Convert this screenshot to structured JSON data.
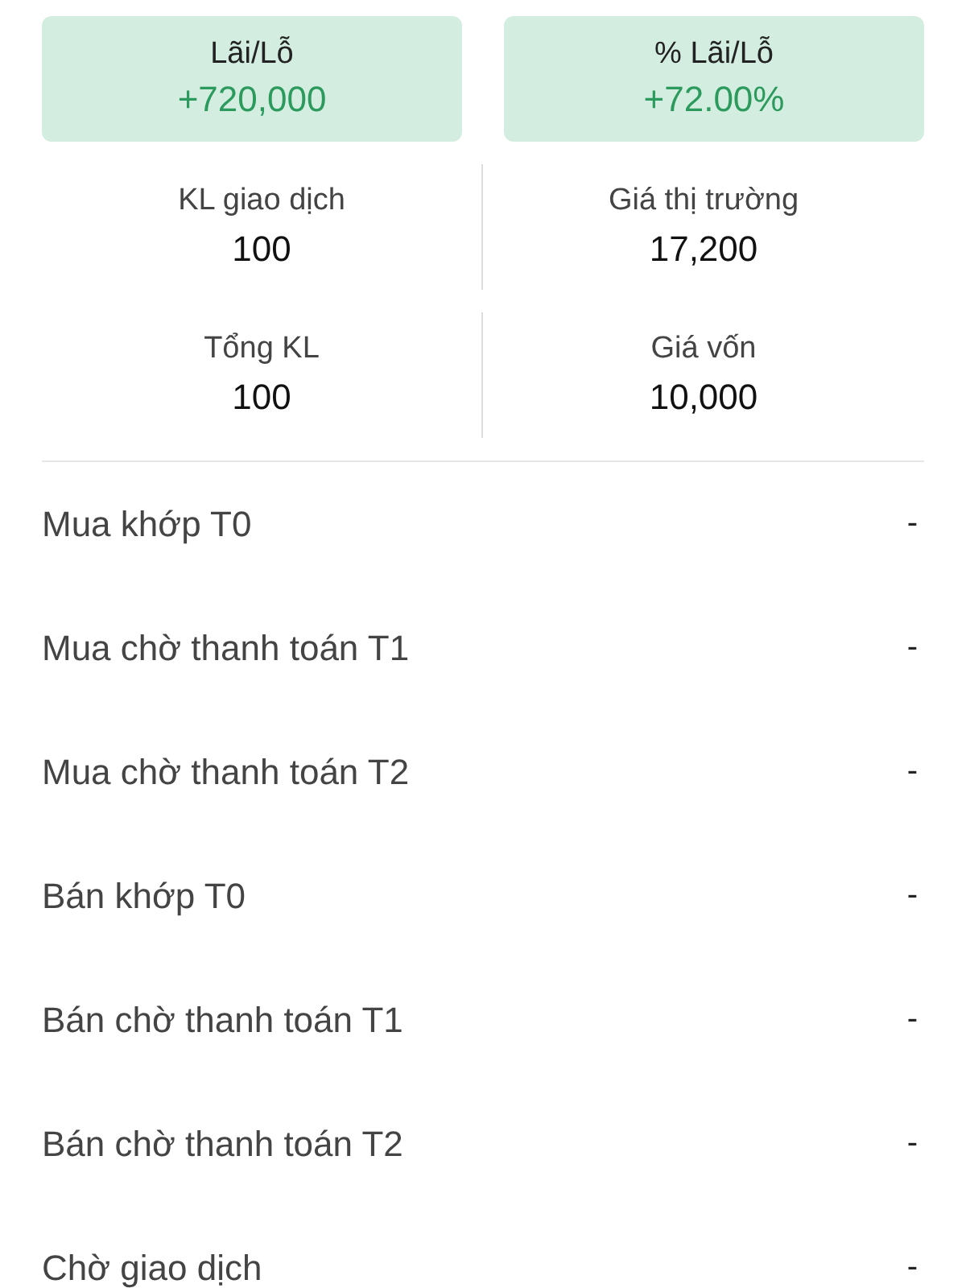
{
  "summary_cards": [
    {
      "label": "Lãi/Lỗ",
      "value": "+720,000"
    },
    {
      "label": "% Lãi/Lỗ",
      "value": "+72.00%"
    }
  ],
  "stats": [
    {
      "label": "KL giao dịch",
      "value": "100"
    },
    {
      "label": "Giá thị trường",
      "value": "17,200"
    },
    {
      "label": "Tổng KL",
      "value": "100"
    },
    {
      "label": "Giá vốn",
      "value": "10,000"
    }
  ],
  "rows": [
    {
      "label": "Mua khớp T0",
      "value": "-"
    },
    {
      "label": "Mua chờ thanh toán T1",
      "value": "-"
    },
    {
      "label": "Mua chờ thanh toán T2",
      "value": "-"
    },
    {
      "label": "Bán khớp T0",
      "value": "-"
    },
    {
      "label": "Bán chờ thanh toán T1",
      "value": "-"
    },
    {
      "label": "Bán chờ thanh toán T2",
      "value": "-"
    },
    {
      "label": "Chờ giao dịch",
      "value": "-"
    }
  ]
}
